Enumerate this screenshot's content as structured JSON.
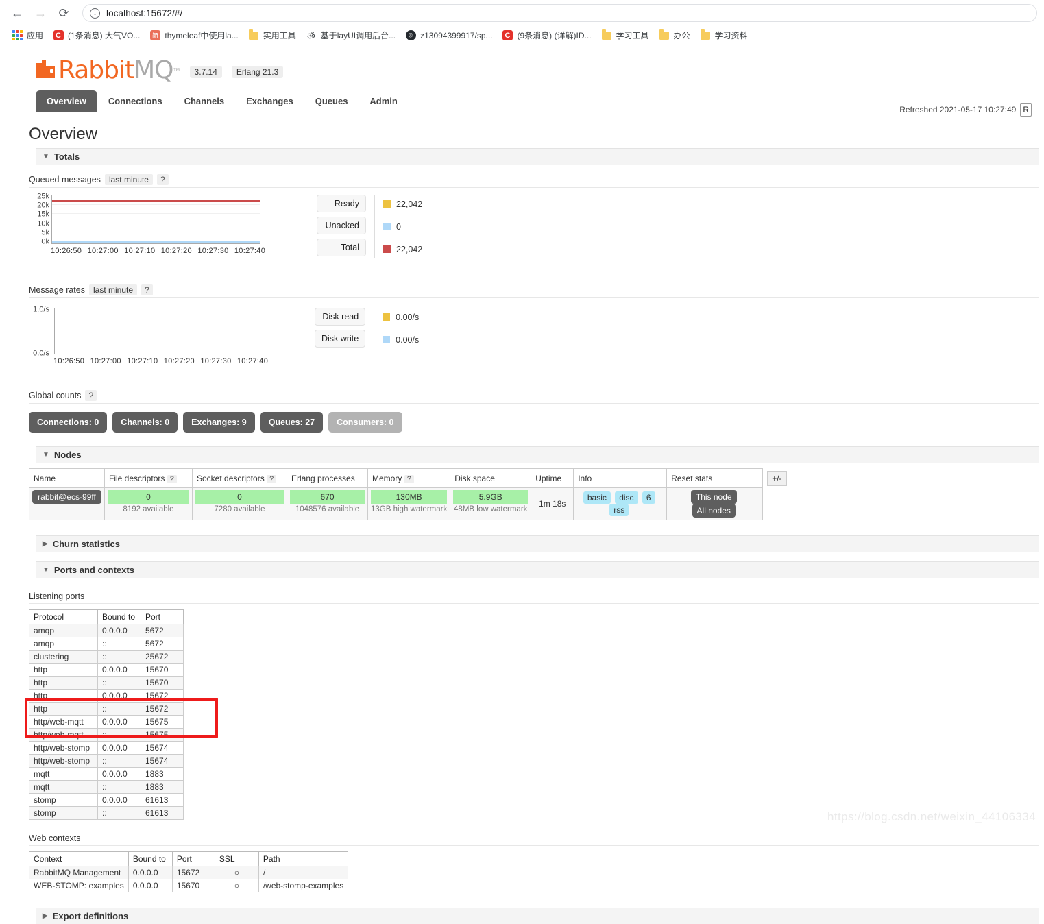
{
  "browser": {
    "back_icon": "←",
    "forward_icon": "→",
    "reload_icon": "⟳",
    "url": "localhost:15672/#/",
    "bookmarks": [
      {
        "label": "应用",
        "icon": "apps-grid-icon"
      },
      {
        "label": "(1条消息) 大气VO...",
        "icon": "csdn-icon"
      },
      {
        "label": "thymeleaf中使用la...",
        "icon": "jianshu-icon"
      },
      {
        "label": "实用工具",
        "icon": "folder-icon"
      },
      {
        "label": "基于layUI调用后台...",
        "icon": "layui-icon"
      },
      {
        "label": "z13094399917/sp...",
        "icon": "github-icon"
      },
      {
        "label": "(9条消息) (详解)ID...",
        "icon": "csdn-icon"
      },
      {
        "label": "学习工具",
        "icon": "folder-icon"
      },
      {
        "label": "办公",
        "icon": "folder-icon"
      },
      {
        "label": "学习资料",
        "icon": "folder-icon"
      }
    ]
  },
  "header": {
    "logo_primary": "Rabbit",
    "logo_secondary": "MQ",
    "trademark": "™",
    "version": "3.7.14",
    "erlang": "Erlang 21.3",
    "refreshed": "Refreshed 2021-05-17 10:27:49",
    "refresh_button": "R"
  },
  "tabs": [
    {
      "label": "Overview",
      "active": true
    },
    {
      "label": "Connections",
      "active": false
    },
    {
      "label": "Channels",
      "active": false
    },
    {
      "label": "Exchanges",
      "active": false
    },
    {
      "label": "Queues",
      "active": false
    },
    {
      "label": "Admin",
      "active": false
    }
  ],
  "page_title": "Overview",
  "sections": {
    "totals": "Totals",
    "nodes": "Nodes",
    "churn": "Churn statistics",
    "ports_contexts": "Ports and contexts",
    "export": "Export definitions"
  },
  "queued_messages": {
    "label": "Queued messages",
    "period": "last minute",
    "help": "?",
    "legend": [
      {
        "name": "Ready",
        "value": "22,042",
        "color": "#edc240"
      },
      {
        "name": "Unacked",
        "value": "0",
        "color": "#afd8f8"
      },
      {
        "name": "Total",
        "value": "22,042",
        "color": "#cb4b4b"
      }
    ]
  },
  "message_rates": {
    "label": "Message rates",
    "period": "last minute",
    "help": "?",
    "legend": [
      {
        "name": "Disk read",
        "value": "0.00/s",
        "color": "#edc240"
      },
      {
        "name": "Disk write",
        "value": "0.00/s",
        "color": "#afd8f8"
      }
    ]
  },
  "chart_data": [
    {
      "type": "line",
      "title": "Queued messages",
      "xlabel": "",
      "ylabel": "",
      "x": [
        "10:26:50",
        "10:27:00",
        "10:27:10",
        "10:27:20",
        "10:27:30",
        "10:27:40"
      ],
      "ytick_labels": [
        "25k",
        "20k",
        "15k",
        "10k",
        "5k",
        "0k"
      ],
      "ylim": [
        0,
        25000
      ],
      "grid": true,
      "legend_position": "right",
      "series": [
        {
          "name": "Total",
          "color": "#cb4b4b",
          "values": [
            22042,
            22042,
            22042,
            22042,
            22042,
            22042
          ]
        },
        {
          "name": "Unacked",
          "color": "#afd8f8",
          "values": [
            0,
            0,
            0,
            0,
            0,
            0
          ]
        },
        {
          "name": "Ready",
          "color": "#edc240",
          "values": [
            22042,
            22042,
            22042,
            22042,
            22042,
            22042
          ]
        }
      ]
    },
    {
      "type": "line",
      "title": "Message rates",
      "xlabel": "",
      "ylabel": "",
      "x": [
        "10:26:50",
        "10:27:00",
        "10:27:10",
        "10:27:20",
        "10:27:30",
        "10:27:40"
      ],
      "ytick_labels": [
        "1.0/s",
        "0.0/s"
      ],
      "ylim": [
        0,
        1
      ],
      "grid": false,
      "legend_position": "right",
      "series": [
        {
          "name": "Disk read",
          "color": "#edc240",
          "values": [
            0,
            0,
            0,
            0,
            0,
            0
          ]
        },
        {
          "name": "Disk write",
          "color": "#afd8f8",
          "values": [
            0,
            0,
            0,
            0,
            0,
            0
          ]
        }
      ]
    }
  ],
  "global_counts": {
    "label": "Global counts",
    "help": "?",
    "items": [
      {
        "label": "Connections: 0",
        "muted": false
      },
      {
        "label": "Channels: 0",
        "muted": false
      },
      {
        "label": "Exchanges: 9",
        "muted": false
      },
      {
        "label": "Queues: 27",
        "muted": false
      },
      {
        "label": "Consumers: 0",
        "muted": true
      }
    ]
  },
  "nodes_table": {
    "headers": [
      "Name",
      "File descriptors",
      "Socket descriptors",
      "Erlang processes",
      "Memory",
      "Disk space",
      "Uptime",
      "Info",
      "Reset stats",
      "+/-"
    ],
    "row": {
      "name": "rabbit@ecs-99ff",
      "file_descriptors": {
        "value": "0",
        "note": "8192 available"
      },
      "socket_descriptors": {
        "value": "0",
        "note": "7280 available"
      },
      "erlang_processes": {
        "value": "670",
        "note": "1048576 available"
      },
      "memory": {
        "value": "130MB",
        "note": "13GB high watermark"
      },
      "disk_space": {
        "value": "5.9GB",
        "note": "48MB low watermark"
      },
      "uptime": "1m 18s",
      "info": [
        "basic",
        "disc",
        "6",
        "rss"
      ],
      "reset_stats": [
        "This node",
        "All nodes"
      ],
      "toggle": "+/-"
    }
  },
  "listening_ports": {
    "label": "Listening ports",
    "headers": [
      "Protocol",
      "Bound to",
      "Port"
    ],
    "rows": [
      [
        "amqp",
        "0.0.0.0",
        "5672"
      ],
      [
        "amqp",
        "::",
        "5672"
      ],
      [
        "clustering",
        "::",
        "25672"
      ],
      [
        "http",
        "0.0.0.0",
        "15670"
      ],
      [
        "http",
        "::",
        "15670"
      ],
      [
        "http",
        "0.0.0.0",
        "15672"
      ],
      [
        "http",
        "::",
        "15672"
      ],
      [
        "http/web-mqtt",
        "0.0.0.0",
        "15675"
      ],
      [
        "http/web-mqtt",
        "::",
        "15675"
      ],
      [
        "http/web-stomp",
        "0.0.0.0",
        "15674"
      ],
      [
        "http/web-stomp",
        "::",
        "15674"
      ],
      [
        "mqtt",
        "0.0.0.0",
        "1883"
      ],
      [
        "mqtt",
        "::",
        "1883"
      ],
      [
        "stomp",
        "0.0.0.0",
        "61613"
      ],
      [
        "stomp",
        "::",
        "61613"
      ]
    ]
  },
  "web_contexts": {
    "label": "Web contexts",
    "headers": [
      "Context",
      "Bound to",
      "Port",
      "SSL",
      "Path"
    ],
    "rows": [
      [
        "RabbitMQ Management",
        "0.0.0.0",
        "15672",
        "○",
        "/"
      ],
      [
        "WEB-STOMP: examples",
        "0.0.0.0",
        "15670",
        "○",
        "/web-stomp-examples"
      ]
    ]
  },
  "watermark": "https://blog.csdn.net/weixin_44106334"
}
